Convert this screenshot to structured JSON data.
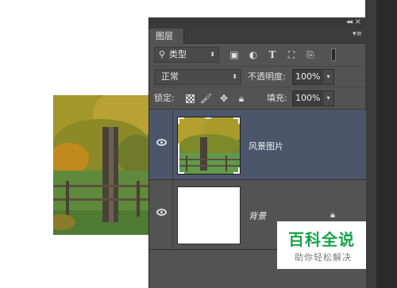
{
  "panel": {
    "tab_label": "图层",
    "collapse_glyph": "◂◂",
    "close_glyph": "×",
    "menu_glyph": "▾≡"
  },
  "filter": {
    "kind_label": "类型",
    "icons": [
      "image-filter-icon",
      "adjustment-filter-icon",
      "type-filter-icon",
      "shape-filter-icon",
      "smart-object-filter-icon"
    ]
  },
  "blend": {
    "mode": "正常",
    "opacity_label": "不透明度:",
    "opacity_value": "100%"
  },
  "lock": {
    "label": "锁定:",
    "fill_label": "填充:",
    "fill_value": "100%"
  },
  "layers": [
    {
      "name": "风景图片",
      "selected": true,
      "visible": true
    },
    {
      "name": "背景",
      "selected": false,
      "visible": true,
      "locked": true
    }
  ],
  "watermark": {
    "title": "百科全说",
    "subtitle": "助你轻松解决"
  },
  "colors": {
    "panel_bg": "#535353",
    "selected_layer": "#4c566b",
    "watermark_green": "#17a34a"
  }
}
